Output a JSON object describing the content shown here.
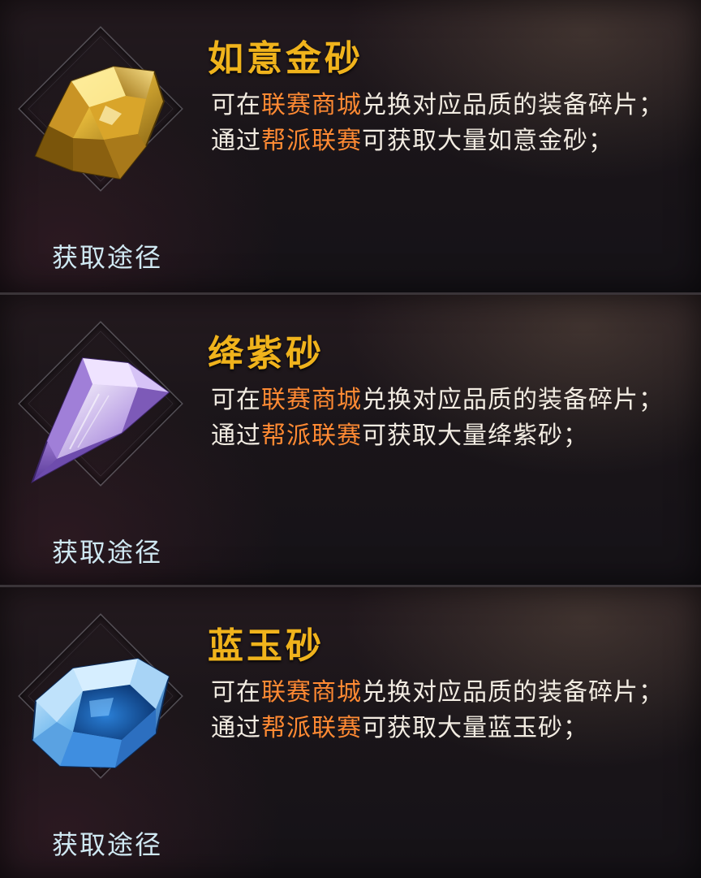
{
  "items": [
    {
      "name": "如意金砂",
      "icon": "gold-sand-icon",
      "line1_prefix": "可在",
      "line1_highlight": "联赛商城",
      "line1_suffix": "兑换对应品质的装备碎片；",
      "line2_prefix": "通过",
      "line2_highlight": "帮派联赛",
      "line2_suffix": "可获取大量如意金砂；",
      "source_label": "获取途径"
    },
    {
      "name": "绛紫砂",
      "icon": "purple-sand-icon",
      "line1_prefix": "可在",
      "line1_highlight": "联赛商城",
      "line1_suffix": "兑换对应品质的装备碎片；",
      "line2_prefix": "通过",
      "line2_highlight": "帮派联赛",
      "line2_suffix": "可获取大量绛紫砂；",
      "source_label": "获取途径"
    },
    {
      "name": "蓝玉砂",
      "icon": "blue-sand-icon",
      "line1_prefix": "可在",
      "line1_highlight": "联赛商城",
      "line1_suffix": "兑换对应品质的装备碎片；",
      "line2_prefix": "通过",
      "line2_highlight": "帮派联赛",
      "line2_suffix": "可获取大量蓝玉砂；",
      "source_label": "获取途径"
    }
  ],
  "colors": {
    "title": "#f0b31c",
    "highlight": "#ff8a33",
    "body_text": "#f2ece2",
    "source_text": "#cfe8f2"
  }
}
